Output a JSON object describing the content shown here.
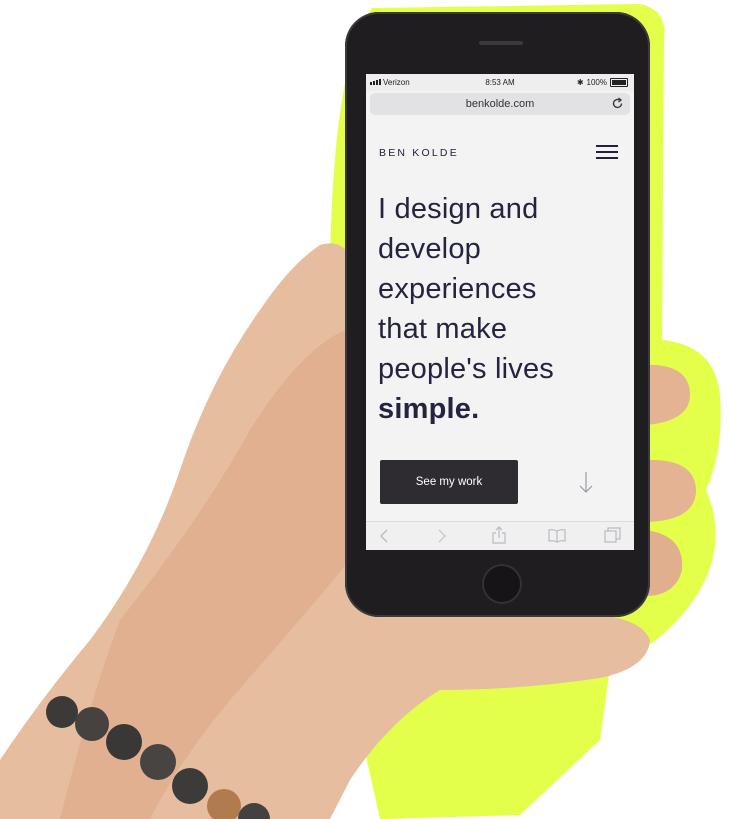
{
  "status_bar": {
    "carrier": "Verizon",
    "time": "8:53 AM",
    "battery": "100%",
    "battery_level": 1.0
  },
  "browser": {
    "url": "benkolde.com"
  },
  "site": {
    "brand": "BEN KOLDE",
    "headline_lines": [
      "I design and",
      "develop",
      "experiences",
      "that make",
      "people's lives"
    ],
    "headline_emphasis": "simple.",
    "cta_label": "See my work"
  },
  "icons": {
    "menu": "hamburger-icon",
    "scroll": "arrow-down-icon",
    "reload": "reload-icon",
    "back": "chevron-left-icon",
    "forward": "chevron-right-icon",
    "share": "share-icon",
    "bookmarks": "book-icon",
    "tabs": "tabs-icon"
  },
  "colors": {
    "background_glow": "#e4ff4a",
    "site_text": "#25243e",
    "cta_background": "#2f2c31",
    "phone_body": "#1f1d1f"
  }
}
